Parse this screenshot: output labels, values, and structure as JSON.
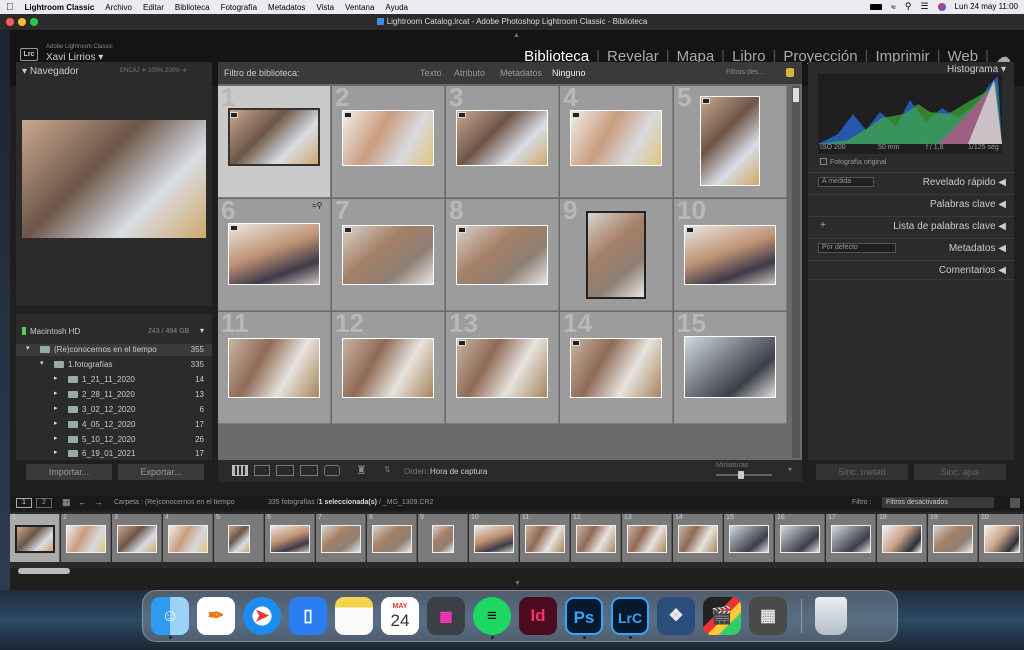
{
  "menubar": {
    "apple": "",
    "app_name": "Lightroom Classic",
    "items": [
      "Archivo",
      "Editar",
      "Biblioteca",
      "Fotografía",
      "Metadatos",
      "Vista",
      "Ventana",
      "Ayuda"
    ],
    "datetime": "Lun 24 may  11:00"
  },
  "window": {
    "title": "Lightroom Catalog.lrcat - Adobe Photoshop Lightroom Classic - Biblioteca"
  },
  "identity": {
    "logo": "Lrc",
    "product": "Adobe Lightroom Classic",
    "user": "Xavi Lirrios"
  },
  "modules": [
    "Biblioteca",
    "Revelar",
    "Mapa",
    "Libro",
    "Proyección",
    "Imprimir",
    "Web"
  ],
  "left_panel": {
    "navigator_label": "Navegador",
    "nav_options": "ENCAJ  ≑   100%   200%  ≑",
    "volume": "Macintosh HD",
    "volume_space": "243 / 494 GB",
    "folders": [
      {
        "label": "(Re)conocernos en el tiempo",
        "count": "355"
      },
      {
        "label": "1.fotografías",
        "count": "335"
      },
      {
        "label": "1_21_11_2020",
        "count": "14"
      },
      {
        "label": "2_28_11_2020",
        "count": "13"
      },
      {
        "label": "3_02_12_2020",
        "count": "6"
      },
      {
        "label": "4_05_12_2020",
        "count": "17"
      },
      {
        "label": "5_10_12_2020",
        "count": "26"
      },
      {
        "label": "6_19_01_2021",
        "count": "17"
      }
    ],
    "import_label": "Importar...",
    "export_label": "Exportar..."
  },
  "filter_bar": {
    "label": "Filtro de biblioteca:",
    "options": [
      "Texto",
      "Atributo",
      "Metadatos",
      "Ninguno"
    ],
    "filters_off": "Filtros des..."
  },
  "grid": {
    "cells": [
      "1",
      "2",
      "3",
      "4",
      "5",
      "6",
      "7",
      "8",
      "9",
      "10",
      "11",
      "12",
      "13",
      "14",
      "15"
    ]
  },
  "toolbar": {
    "sort_label": "Orden:",
    "sort_value": "Hora de captura",
    "thumb_label": "Miniaturas"
  },
  "right_panel": {
    "histogram_label": "Histograma",
    "iso": "ISO 200",
    "focal": "50 mm",
    "aperture": "f / 1,8",
    "shutter": "1/125 seg",
    "original_photo": "Fotografía original",
    "quick_develop_preset": "A medida",
    "quick_develop": "Revelado rápido",
    "keywords": "Palabras clave",
    "keyword_list": "Lista de palabras clave",
    "metadata_preset": "Por defecto",
    "metadata": "Metadatos",
    "comments": "Comentarios",
    "sync_meta": "Sinc. metad",
    "sync_settings": "Sinc. ajus"
  },
  "filmstrip": {
    "view_buttons": [
      "1",
      "2"
    ],
    "path_label": "Carpeta : (Re)conocernos en el tiempo",
    "count_label": "335 fotografías /",
    "selection": "1 seleccionada(s)",
    "filename": " / _MG_1309.CR2",
    "filter_label": "Filtro :",
    "filter_value": "Filtros desactivados",
    "thumb_numbers": [
      "1",
      "2",
      "3",
      "4",
      "5",
      "6",
      "7",
      "8",
      "9",
      "10",
      "11",
      "12",
      "13",
      "14",
      "15",
      "16",
      "17",
      "18",
      "19",
      "20"
    ]
  },
  "dock": {
    "calendar_month": "MAY",
    "calendar_day": "24",
    "apps": [
      "finder-icon",
      "pages-icon",
      "safari-icon",
      "keynote-icon",
      "notes-icon",
      "calendar-icon",
      "launchpad-icon",
      "spotify-icon",
      "indesign-icon",
      "photoshop-icon",
      "lightroom-icon",
      "davinci-icon",
      "finalcut-icon",
      "calculator-icon",
      "trash-icon"
    ],
    "indesign": "Id",
    "photoshop": "Ps",
    "lightroom": "LrC"
  }
}
